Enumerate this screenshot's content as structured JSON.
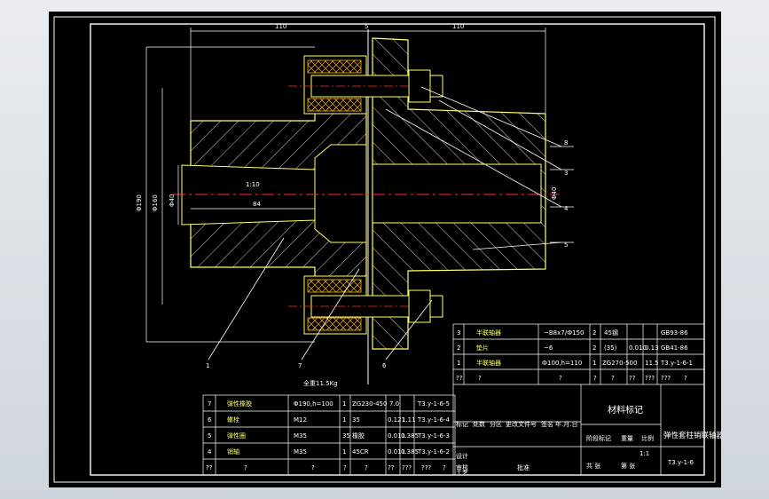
{
  "drawing": {
    "dimensions": {
      "top_left": "110",
      "top_gap": "5",
      "top_right": "110",
      "left_1": "Φ190",
      "left_2": "Φ160",
      "left_3": "Φ40",
      "bore_length": "84",
      "taper": "1:10",
      "right_bore": "Φ40"
    },
    "balloons": [
      "8",
      "3",
      "4",
      "5",
      "1",
      "7",
      "6"
    ],
    "note": "全重11.5Kg"
  },
  "parts_table": {
    "rows": [
      {
        "no": "7",
        "name": "弹性橡胶",
        "spec": "Φ190,h=100",
        "qty": "1",
        "mat": "ZG230-450",
        "unit": "7.0",
        "total": "",
        "ref": "T3.y-1-6-5"
      },
      {
        "no": "6",
        "name": "螺栓",
        "spec": "M12",
        "qty": "1",
        "mat": "35",
        "unit": "0.121",
        "total": "1.11",
        "ref": "T3.y-1-6-4"
      },
      {
        "no": "5",
        "name": "弹性圈",
        "spec": "M35",
        "qty": "35",
        "mat": "橡胶",
        "unit": "0.011",
        "total": "0.385",
        "ref": "T3.y-1-6-3"
      },
      {
        "no": "4",
        "name": "销轴",
        "spec": "M35",
        "qty": "1",
        "mat": "45CR",
        "unit": "0.011",
        "total": "0.385",
        "ref": "T3.y-1-6-2"
      }
    ],
    "footer": [
      "??",
      "?",
      "?",
      "?",
      "?",
      "??",
      "???",
      "???",
      "?"
    ]
  },
  "title_block": {
    "right_rows": [
      {
        "no": "3",
        "name": "半联轴器",
        "spec": "~B8x7/Ф150",
        "qty": "2",
        "mat": "45钢",
        "unit": "",
        "total": "",
        "ref": "GB93-86"
      },
      {
        "no": "2",
        "name": "垫片",
        "spec": "~6",
        "qty": "2",
        "mat": "(35)",
        "unit": "0.010",
        "total": "0.13",
        "ref": "GB41-86"
      },
      {
        "no": "1",
        "name": "半联轴器",
        "spec": "Ф100,h=110",
        "qty": "1",
        "mat": "ZG270-500",
        "unit": "11.5",
        "total": "",
        "ref": "T3.y-1-6-1"
      }
    ],
    "header_row": [
      "??",
      "?",
      "?",
      "?",
      "?",
      "??",
      "???",
      "???",
      "?"
    ],
    "material_mark": "材料标记",
    "drawing_name": "弹性套柱销联轴器",
    "left_labels": [
      "标记",
      "处数",
      "分区",
      "更改文件号",
      "签名",
      "年.月.日"
    ],
    "left_labels_2": [
      "设计",
      "审核",
      "工艺",
      "批准"
    ],
    "stage_labels": [
      "阶段标记",
      "重量",
      "比例"
    ],
    "scale": "1:1",
    "sheet_text": [
      "共 张",
      "第 张"
    ],
    "drawing_no": "T3.y-1-6"
  }
}
